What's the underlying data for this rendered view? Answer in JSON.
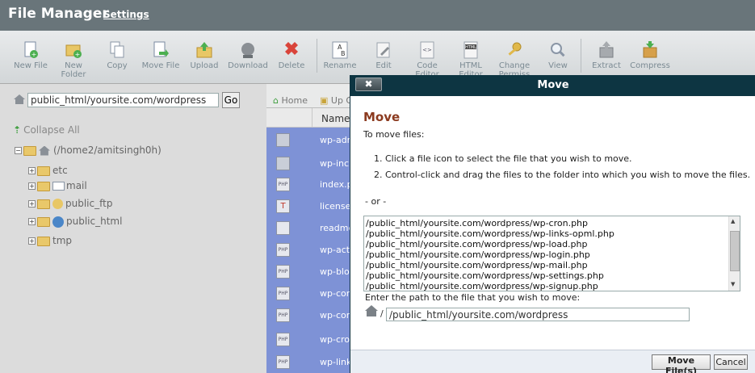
{
  "header": {
    "title": "File Manager",
    "settings": "Settings"
  },
  "toolbar": {
    "items": [
      {
        "line1": "New File",
        "line2": ""
      },
      {
        "line1": "New",
        "line2": "Folder"
      },
      {
        "line1": "Copy",
        "line2": ""
      },
      {
        "line1": "Move File",
        "line2": ""
      },
      {
        "line1": "Upload",
        "line2": ""
      },
      {
        "line1": "Download",
        "line2": ""
      },
      {
        "line1": "Delete",
        "line2": ""
      },
      {
        "line1": "Rename",
        "line2": ""
      },
      {
        "line1": "Edit",
        "line2": ""
      },
      {
        "line1": "Code",
        "line2": "Editor"
      },
      {
        "line1": "HTML",
        "line2": "Editor"
      },
      {
        "line1": "Change",
        "line2": "Permiss"
      },
      {
        "line1": "View",
        "line2": ""
      },
      {
        "line1": "Extract",
        "line2": ""
      },
      {
        "line1": "Compress",
        "line2": ""
      }
    ]
  },
  "left": {
    "path_value": "public_html/yoursite.com/wordpress",
    "go": "Go",
    "collapse_all": "Collapse All",
    "root": "(/home2/amitsingh0h)",
    "folders": [
      "etc",
      "mail",
      "public_ftp",
      "public_html",
      "tmp"
    ]
  },
  "file_nav": {
    "home": "Home",
    "up": "Up O"
  },
  "file_list": {
    "name_col": "Name",
    "files": [
      {
        "name": "wp-adm",
        "icon": "folder"
      },
      {
        "name": "wp-inclu",
        "icon": "folder"
      },
      {
        "name": "index.p",
        "icon": "PHP"
      },
      {
        "name": "license.",
        "icon": "T"
      },
      {
        "name": "readme",
        "icon": "web"
      },
      {
        "name": "wp-acti",
        "icon": "PHP"
      },
      {
        "name": "wp-blog",
        "icon": "PHP"
      },
      {
        "name": "wp-con",
        "icon": "PHP"
      },
      {
        "name": "wp-con",
        "icon": "PHP"
      },
      {
        "name": "wp-cror",
        "icon": "PHP"
      },
      {
        "name": "wp-link",
        "icon": "PHP"
      }
    ]
  },
  "modal": {
    "title": "Move",
    "close": "✖",
    "heading": "Move",
    "to_move": "To move files:",
    "step1": "1. Click a file icon to select the file that you wish to move.",
    "step2": "2. Control-click and drag the files to the folder into which you wish to move the files.",
    "or": "- or -",
    "files": [
      "/public_html/yoursite.com/wordpress/wp-cron.php",
      "/public_html/yoursite.com/wordpress/wp-links-opml.php",
      "/public_html/yoursite.com/wordpress/wp-load.php",
      "/public_html/yoursite.com/wordpress/wp-login.php",
      "/public_html/yoursite.com/wordpress/wp-mail.php",
      "/public_html/yoursite.com/wordpress/wp-settings.php",
      "/public_html/yoursite.com/wordpress/wp-signup.php"
    ],
    "enter_path": "Enter the path to the file that you wish to move:",
    "dest_slash": "/",
    "dest_value": "/public_html/yoursite.com/wordpress",
    "move_btn": "Move File(s)",
    "cancel_btn": "Cancel"
  },
  "colors": {
    "header": "#69757a",
    "modal_titlebar": "#0d3542",
    "selection": "#7e92d6",
    "heading": "#8b3a1f"
  }
}
